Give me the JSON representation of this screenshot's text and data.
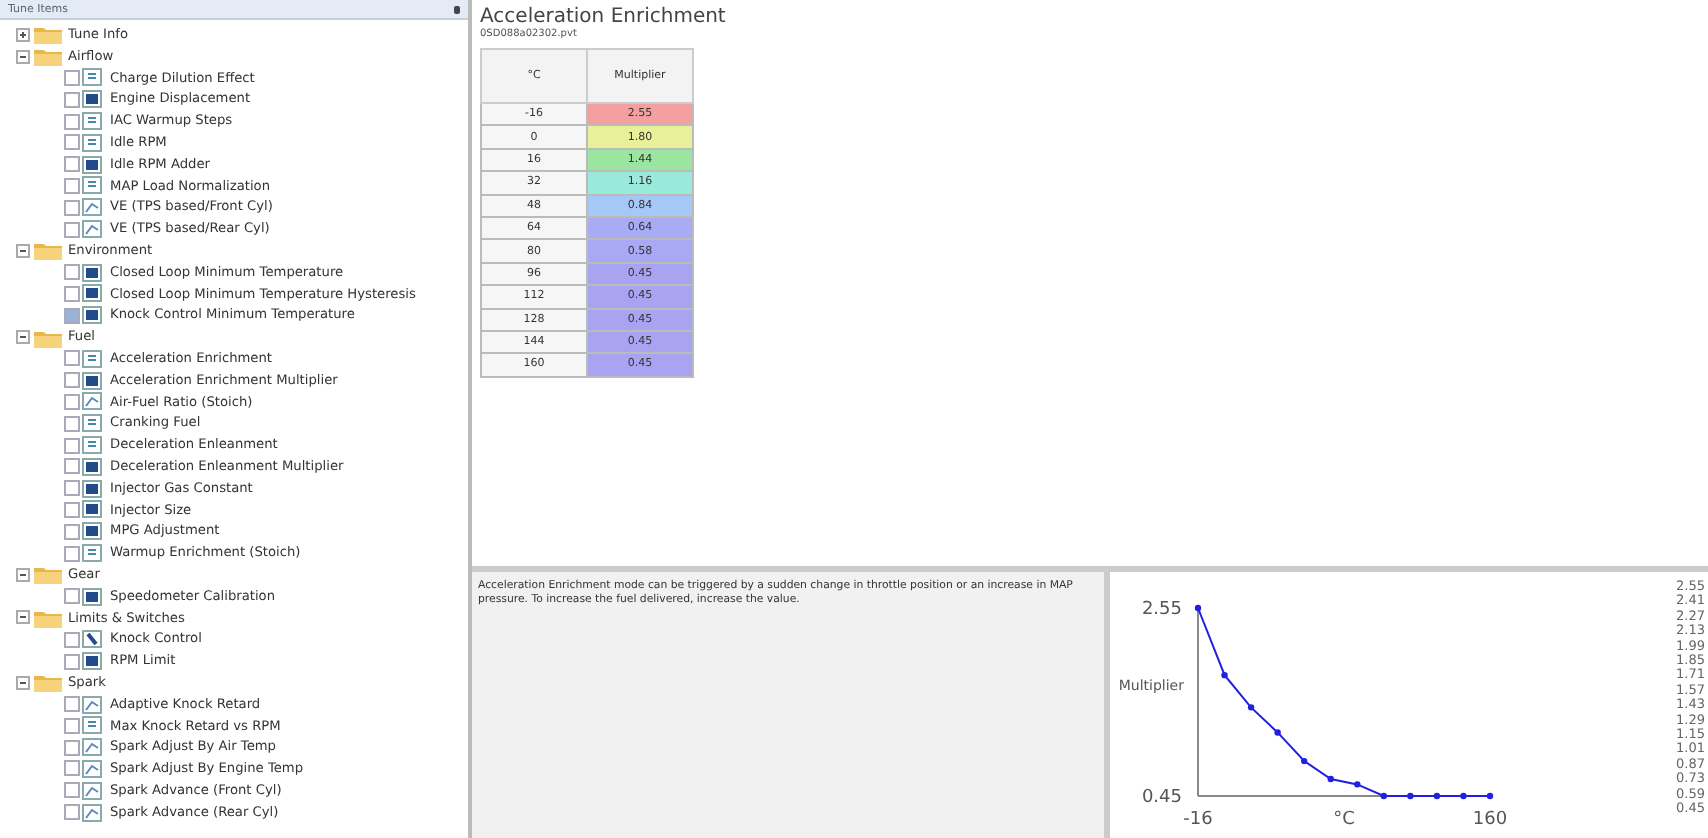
{
  "sidebar": {
    "title": "Tune Items",
    "groups": [
      {
        "label": "Tune Info",
        "expanded": false
      },
      {
        "label": "Airflow",
        "expanded": true,
        "children": [
          {
            "label": "Charge Dilution Effect",
            "kind": "value",
            "checked": false
          },
          {
            "label": "Engine Displacement",
            "kind": "table",
            "checked": false
          },
          {
            "label": "IAC Warmup Steps",
            "kind": "value",
            "checked": false
          },
          {
            "label": "Idle RPM",
            "kind": "value",
            "checked": false
          },
          {
            "label": "Idle RPM Adder",
            "kind": "table",
            "checked": false
          },
          {
            "label": "MAP Load Normalization",
            "kind": "value",
            "checked": false
          },
          {
            "label": "VE (TPS based/Front Cyl)",
            "kind": "map",
            "checked": false
          },
          {
            "label": "VE (TPS based/Rear Cyl)",
            "kind": "map",
            "checked": false
          }
        ]
      },
      {
        "label": "Environment",
        "expanded": true,
        "children": [
          {
            "label": "Closed Loop Minimum Temperature",
            "kind": "table",
            "checked": false
          },
          {
            "label": "Closed Loop Minimum Temperature Hysteresis",
            "kind": "table",
            "checked": false
          },
          {
            "label": "Knock Control Minimum Temperature",
            "kind": "table",
            "checked": true
          }
        ]
      },
      {
        "label": "Fuel",
        "expanded": true,
        "children": [
          {
            "label": "Acceleration Enrichment",
            "kind": "value",
            "checked": false
          },
          {
            "label": "Acceleration Enrichment Multiplier",
            "kind": "table",
            "checked": false
          },
          {
            "label": "Air-Fuel Ratio (Stoich)",
            "kind": "map",
            "checked": false
          },
          {
            "label": "Cranking Fuel",
            "kind": "value",
            "checked": false
          },
          {
            "label": "Deceleration Enleanment",
            "kind": "value",
            "checked": false
          },
          {
            "label": "Deceleration Enleanment Multiplier",
            "kind": "table",
            "checked": false
          },
          {
            "label": "Injector Gas Constant",
            "kind": "table",
            "checked": false
          },
          {
            "label": "Injector Size",
            "kind": "table",
            "checked": false
          },
          {
            "label": "MPG Adjustment",
            "kind": "table",
            "checked": false
          },
          {
            "label": "Warmup Enrichment (Stoich)",
            "kind": "value",
            "checked": false
          }
        ]
      },
      {
        "label": "Gear",
        "expanded": true,
        "children": [
          {
            "label": "Speedometer Calibration",
            "kind": "table",
            "checked": false
          }
        ]
      },
      {
        "label": "Limits & Switches",
        "expanded": true,
        "children": [
          {
            "label": "Knock Control",
            "kind": "switch",
            "checked": false
          },
          {
            "label": "RPM Limit",
            "kind": "table",
            "checked": false
          }
        ]
      },
      {
        "label": "Spark",
        "expanded": true,
        "children": [
          {
            "label": "Adaptive Knock Retard",
            "kind": "map",
            "checked": false
          },
          {
            "label": "Max Knock Retard vs RPM",
            "kind": "value",
            "checked": false
          },
          {
            "label": "Spark Adjust By Air Temp",
            "kind": "map",
            "checked": false
          },
          {
            "label": "Spark Adjust By Engine Temp",
            "kind": "map",
            "checked": false
          },
          {
            "label": "Spark Advance (Front Cyl)",
            "kind": "map",
            "checked": false
          },
          {
            "label": "Spark Advance (Rear Cyl)",
            "kind": "map",
            "checked": false
          }
        ]
      }
    ]
  },
  "editor": {
    "title": "Acceleration Enrichment",
    "file": "0SD088a02302.pvt",
    "table": {
      "columns": [
        "°C",
        "Multiplier"
      ],
      "rows": [
        {
          "key": "-16",
          "value": "2.55",
          "color": "#f4a0a0"
        },
        {
          "key": "0",
          "value": "1.80",
          "color": "#e8f09a"
        },
        {
          "key": "16",
          "value": "1.44",
          "color": "#9ae6a0"
        },
        {
          "key": "32",
          "value": "1.16",
          "color": "#9aeadc"
        },
        {
          "key": "48",
          "value": "0.84",
          "color": "#a6c8f6"
        },
        {
          "key": "64",
          "value": "0.64",
          "color": "#a8acf4"
        },
        {
          "key": "80",
          "value": "0.58",
          "color": "#a8a8f4"
        },
        {
          "key": "96",
          "value": "0.45",
          "color": "#a8a4f2"
        },
        {
          "key": "112",
          "value": "0.45",
          "color": "#a8a4f2"
        },
        {
          "key": "128",
          "value": "0.45",
          "color": "#a8a4f2"
        },
        {
          "key": "144",
          "value": "0.45",
          "color": "#a8a4f2"
        },
        {
          "key": "160",
          "value": "0.45",
          "color": "#a8a4f2"
        }
      ]
    }
  },
  "description": "Acceleration Enrichment mode can be triggered by a sudden change in throttle position or an increase in MAP pressure.  To increase the fuel delivered, increase the value.",
  "graph": {
    "chart_data": {
      "type": "line",
      "xlabel": "°C",
      "ylabel": "Multiplier",
      "x": [
        -16,
        0,
        16,
        32,
        48,
        64,
        80,
        96,
        112,
        128,
        144,
        160
      ],
      "series": [
        {
          "color": "#2020e0",
          "marker": true,
          "values": [
            2.55,
            1.8,
            1.44,
            1.16,
            0.84,
            0.64,
            0.58,
            0.45,
            0.45,
            0.45,
            0.45,
            0.45
          ]
        }
      ],
      "xlim": [
        -16,
        160
      ],
      "ylim": [
        0.45,
        2.55
      ],
      "xticks": [
        -16,
        160
      ],
      "yticks": [
        0.45,
        2.55
      ]
    },
    "legend": [
      "2.55",
      "2.41",
      "2.27",
      "2.13",
      "1.99",
      "1.85",
      "1.71",
      "1.57",
      "1.43",
      "1.29",
      "1.15",
      "1.01",
      "0.87",
      "0.73",
      "0.59",
      "0.45"
    ]
  }
}
